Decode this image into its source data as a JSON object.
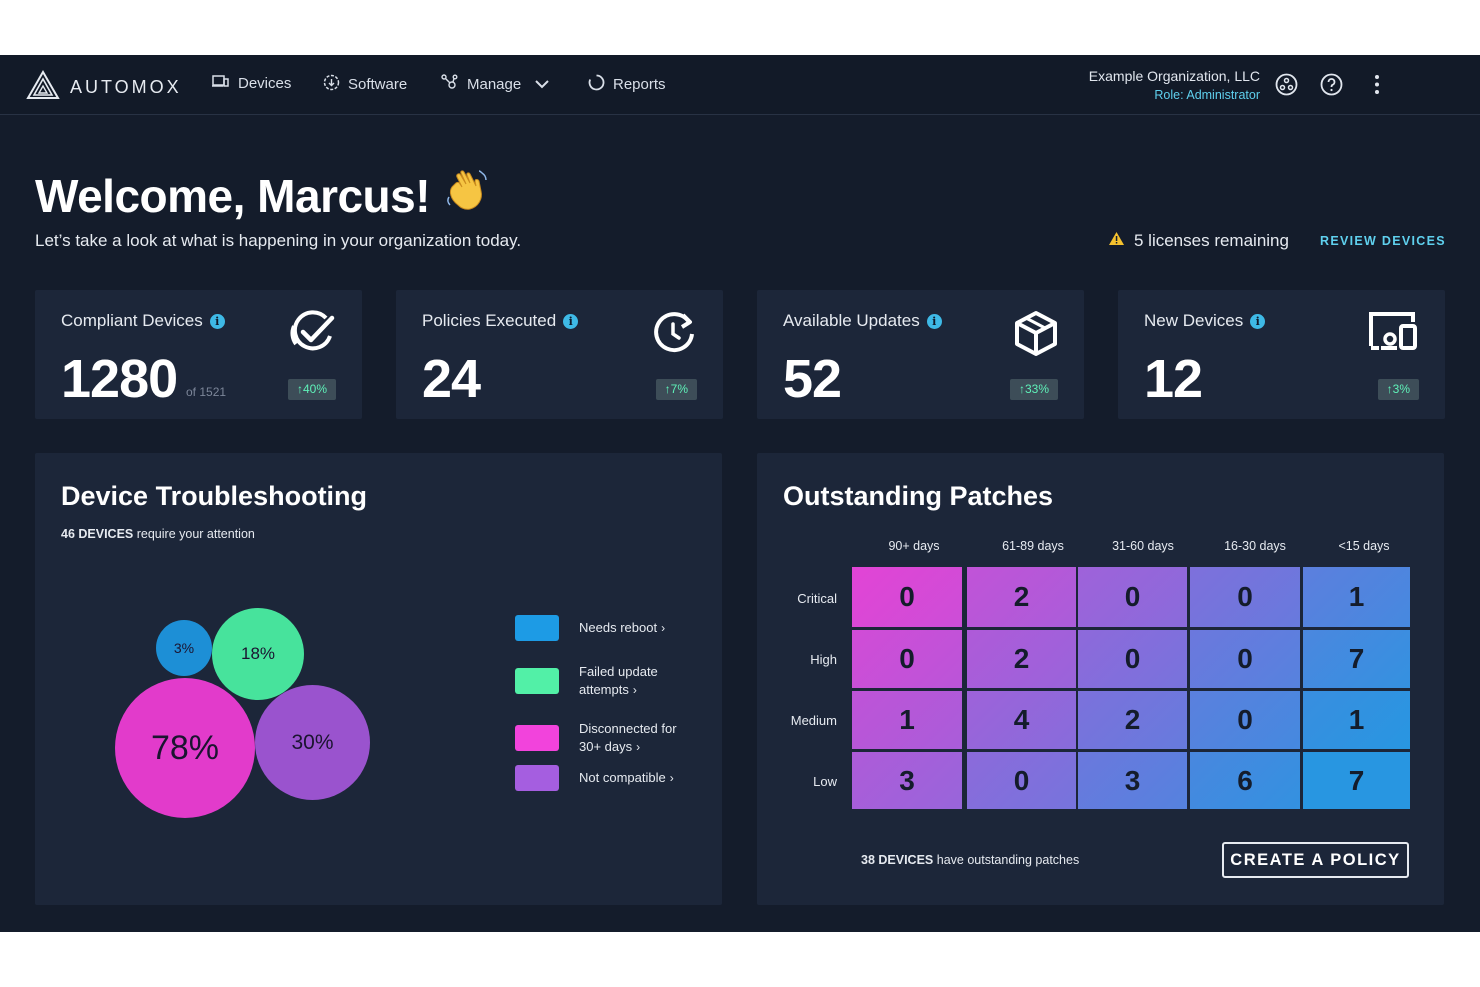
{
  "nav": {
    "brand": "AUTOMOX",
    "items": [
      {
        "label": "Devices",
        "icon": "devices-icon"
      },
      {
        "label": "Software",
        "icon": "software-icon"
      },
      {
        "label": "Manage",
        "icon": "manage-icon"
      },
      {
        "label": "Reports",
        "icon": "reports-icon"
      }
    ],
    "org_name": "Example Organization, LLC",
    "org_role": "Role: Administrator"
  },
  "header": {
    "welcome": "Welcome, Marcus!",
    "subtitle": "Let’s take a look at what is happening in your organization today.",
    "licenses": "5 licenses remaining",
    "review": "REVIEW DEVICES"
  },
  "stats": [
    {
      "label": "Compliant Devices",
      "value": "1280",
      "of": "of 1521",
      "change": "↑40%",
      "icon": "compliant-check-icon"
    },
    {
      "label": "Policies Executed",
      "value": "24",
      "change": "↑7%",
      "icon": "policy-clock-icon"
    },
    {
      "label": "Available Updates",
      "value": "52",
      "change": "↑33%",
      "icon": "package-icon"
    },
    {
      "label": "New Devices",
      "value": "12",
      "change": "↑3%",
      "icon": "new-devices-icon"
    }
  ],
  "troubleshooting": {
    "title": "Device Troubleshooting",
    "sub_bold": "46 DEVICES",
    "sub_rest": " require your attention",
    "bubbles": [
      "3%",
      "18%",
      "78%",
      "30%"
    ],
    "legend": [
      {
        "label": "Needs reboot",
        "color": "#1d9be5"
      },
      {
        "label": "Failed update attempts",
        "color": "#52f0a7"
      },
      {
        "label": "Disconnected for 30+ days",
        "color": "#f243dc"
      },
      {
        "label": "Not compatible",
        "color": "#a55ee0"
      }
    ]
  },
  "patches": {
    "title": "Outstanding Patches",
    "columns": [
      "90+ days",
      "61-89 days",
      "31-60 days",
      "16-30 days",
      "<15 days"
    ],
    "rows": [
      {
        "label": "Critical",
        "values": [
          "0",
          "2",
          "0",
          "0",
          "1"
        ]
      },
      {
        "label": "High",
        "values": [
          "0",
          "2",
          "0",
          "0",
          "7"
        ]
      },
      {
        "label": "Medium",
        "values": [
          "1",
          "4",
          "2",
          "0",
          "1"
        ]
      },
      {
        "label": "Low",
        "values": [
          "3",
          "0",
          "3",
          "6",
          "7"
        ]
      }
    ],
    "foot_bold": "38 DEVICES",
    "foot_rest": " have outstanding patches",
    "button": "CREATE A POLICY"
  }
}
